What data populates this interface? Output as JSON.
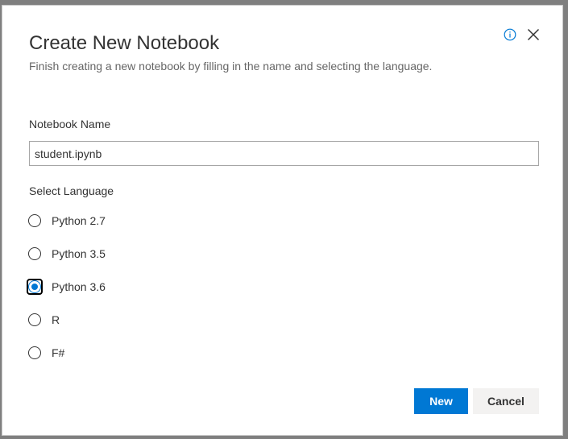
{
  "dialog": {
    "title": "Create New Notebook",
    "subtitle": "Finish creating a new notebook by filling in the name and selecting the language.",
    "info_icon": "info-icon",
    "close_icon": "close-icon"
  },
  "form": {
    "name_label": "Notebook Name",
    "name_value": "student.ipynb",
    "language_label": "Select Language",
    "languages": [
      {
        "label": "Python 2.7",
        "selected": false
      },
      {
        "label": "Python 3.5",
        "selected": false
      },
      {
        "label": "Python 3.6",
        "selected": true
      },
      {
        "label": "R",
        "selected": false
      },
      {
        "label": "F#",
        "selected": false
      }
    ],
    "selected_language": "Python 3.6"
  },
  "actions": {
    "primary_label": "New",
    "secondary_label": "Cancel"
  },
  "colors": {
    "accent": "#0078d4",
    "text": "#333333",
    "subtext": "#666666",
    "secondary_button_bg": "#f3f2f1"
  }
}
